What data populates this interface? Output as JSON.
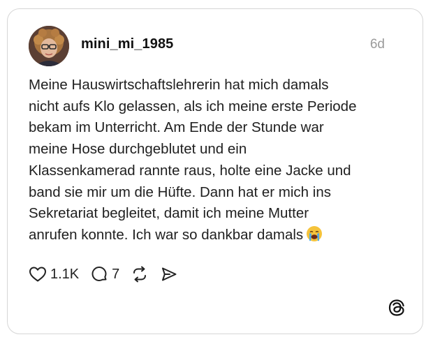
{
  "post": {
    "username": "mini_mi_1985",
    "timestamp": "6d",
    "text_lines": [
      "Meine Hauswirtschaftslehrerin hat mich damals",
      "nicht aufs Klo gelassen, als ich meine erste Periode",
      "bekam im Unterricht. Am Ende der Stunde war",
      "meine Hose durchgeblutet und ein",
      "Klassenkamerad rannte raus, holte eine Jacke und",
      "band sie mir um die Hüfte. Dann hat er mich ins",
      "Sekretariat begleitet, damit ich meine Mutter",
      "anrufen konnte. Ich war so dankbar damals"
    ],
    "emoji": "loudly-crying-face"
  },
  "actions": {
    "likes": "1.1K",
    "comments": "7"
  },
  "icons": {
    "like": "heart-icon",
    "comment": "comment-bubble-icon",
    "repost": "repost-icon",
    "share": "share-send-icon",
    "brand": "threads-logo-icon"
  }
}
